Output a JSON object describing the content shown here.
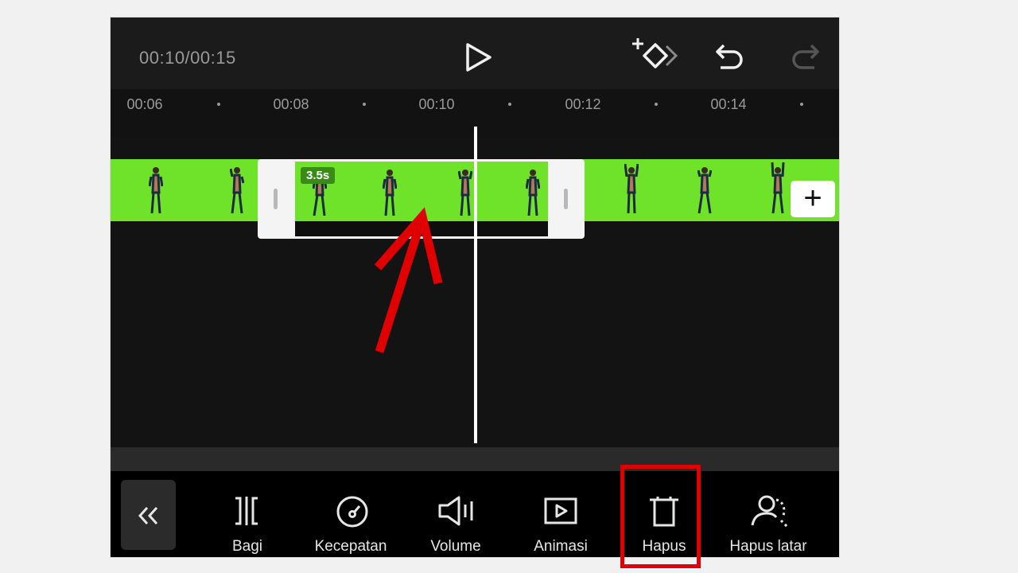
{
  "header": {
    "time": "00:10/00:15"
  },
  "ruler": {
    "ticks": [
      "00:06",
      "00:08",
      "00:10",
      "00:12",
      "00:14"
    ]
  },
  "clip": {
    "duration": "3.5s"
  },
  "toolbar": {
    "items": [
      {
        "label": "Bagi",
        "icon": "split-icon"
      },
      {
        "label": "Kecepatan",
        "icon": "speed-icon"
      },
      {
        "label": "Volume",
        "icon": "volume-icon"
      },
      {
        "label": "Animasi",
        "icon": "animation-icon"
      },
      {
        "label": "Hapus",
        "icon": "delete-icon"
      },
      {
        "label": "Hapus latar",
        "icon": "remove-background-icon"
      }
    ]
  },
  "colors": {
    "track_green": "#6fe22a",
    "highlight_red": "#e00000",
    "background": "#131313"
  }
}
